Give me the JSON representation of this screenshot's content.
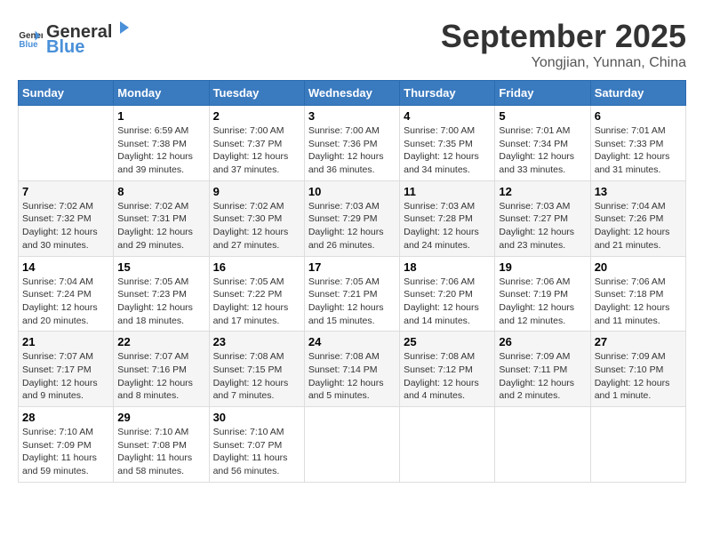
{
  "header": {
    "logo_general": "General",
    "logo_blue": "Blue",
    "month_title": "September 2025",
    "location": "Yongjian, Yunnan, China"
  },
  "weekdays": [
    "Sunday",
    "Monday",
    "Tuesday",
    "Wednesday",
    "Thursday",
    "Friday",
    "Saturday"
  ],
  "weeks": [
    [
      {
        "day": "",
        "info": ""
      },
      {
        "day": "1",
        "info": "Sunrise: 6:59 AM\nSunset: 7:38 PM\nDaylight: 12 hours and 39 minutes."
      },
      {
        "day": "2",
        "info": "Sunrise: 7:00 AM\nSunset: 7:37 PM\nDaylight: 12 hours and 37 minutes."
      },
      {
        "day": "3",
        "info": "Sunrise: 7:00 AM\nSunset: 7:36 PM\nDaylight: 12 hours and 36 minutes."
      },
      {
        "day": "4",
        "info": "Sunrise: 7:00 AM\nSunset: 7:35 PM\nDaylight: 12 hours and 34 minutes."
      },
      {
        "day": "5",
        "info": "Sunrise: 7:01 AM\nSunset: 7:34 PM\nDaylight: 12 hours and 33 minutes."
      },
      {
        "day": "6",
        "info": "Sunrise: 7:01 AM\nSunset: 7:33 PM\nDaylight: 12 hours and 31 minutes."
      }
    ],
    [
      {
        "day": "7",
        "info": "Sunrise: 7:02 AM\nSunset: 7:32 PM\nDaylight: 12 hours and 30 minutes."
      },
      {
        "day": "8",
        "info": "Sunrise: 7:02 AM\nSunset: 7:31 PM\nDaylight: 12 hours and 29 minutes."
      },
      {
        "day": "9",
        "info": "Sunrise: 7:02 AM\nSunset: 7:30 PM\nDaylight: 12 hours and 27 minutes."
      },
      {
        "day": "10",
        "info": "Sunrise: 7:03 AM\nSunset: 7:29 PM\nDaylight: 12 hours and 26 minutes."
      },
      {
        "day": "11",
        "info": "Sunrise: 7:03 AM\nSunset: 7:28 PM\nDaylight: 12 hours and 24 minutes."
      },
      {
        "day": "12",
        "info": "Sunrise: 7:03 AM\nSunset: 7:27 PM\nDaylight: 12 hours and 23 minutes."
      },
      {
        "day": "13",
        "info": "Sunrise: 7:04 AM\nSunset: 7:26 PM\nDaylight: 12 hours and 21 minutes."
      }
    ],
    [
      {
        "day": "14",
        "info": "Sunrise: 7:04 AM\nSunset: 7:24 PM\nDaylight: 12 hours and 20 minutes."
      },
      {
        "day": "15",
        "info": "Sunrise: 7:05 AM\nSunset: 7:23 PM\nDaylight: 12 hours and 18 minutes."
      },
      {
        "day": "16",
        "info": "Sunrise: 7:05 AM\nSunset: 7:22 PM\nDaylight: 12 hours and 17 minutes."
      },
      {
        "day": "17",
        "info": "Sunrise: 7:05 AM\nSunset: 7:21 PM\nDaylight: 12 hours and 15 minutes."
      },
      {
        "day": "18",
        "info": "Sunrise: 7:06 AM\nSunset: 7:20 PM\nDaylight: 12 hours and 14 minutes."
      },
      {
        "day": "19",
        "info": "Sunrise: 7:06 AM\nSunset: 7:19 PM\nDaylight: 12 hours and 12 minutes."
      },
      {
        "day": "20",
        "info": "Sunrise: 7:06 AM\nSunset: 7:18 PM\nDaylight: 12 hours and 11 minutes."
      }
    ],
    [
      {
        "day": "21",
        "info": "Sunrise: 7:07 AM\nSunset: 7:17 PM\nDaylight: 12 hours and 9 minutes."
      },
      {
        "day": "22",
        "info": "Sunrise: 7:07 AM\nSunset: 7:16 PM\nDaylight: 12 hours and 8 minutes."
      },
      {
        "day": "23",
        "info": "Sunrise: 7:08 AM\nSunset: 7:15 PM\nDaylight: 12 hours and 7 minutes."
      },
      {
        "day": "24",
        "info": "Sunrise: 7:08 AM\nSunset: 7:14 PM\nDaylight: 12 hours and 5 minutes."
      },
      {
        "day": "25",
        "info": "Sunrise: 7:08 AM\nSunset: 7:12 PM\nDaylight: 12 hours and 4 minutes."
      },
      {
        "day": "26",
        "info": "Sunrise: 7:09 AM\nSunset: 7:11 PM\nDaylight: 12 hours and 2 minutes."
      },
      {
        "day": "27",
        "info": "Sunrise: 7:09 AM\nSunset: 7:10 PM\nDaylight: 12 hours and 1 minute."
      }
    ],
    [
      {
        "day": "28",
        "info": "Sunrise: 7:10 AM\nSunset: 7:09 PM\nDaylight: 11 hours and 59 minutes."
      },
      {
        "day": "29",
        "info": "Sunrise: 7:10 AM\nSunset: 7:08 PM\nDaylight: 11 hours and 58 minutes."
      },
      {
        "day": "30",
        "info": "Sunrise: 7:10 AM\nSunset: 7:07 PM\nDaylight: 11 hours and 56 minutes."
      },
      {
        "day": "",
        "info": ""
      },
      {
        "day": "",
        "info": ""
      },
      {
        "day": "",
        "info": ""
      },
      {
        "day": "",
        "info": ""
      }
    ]
  ]
}
